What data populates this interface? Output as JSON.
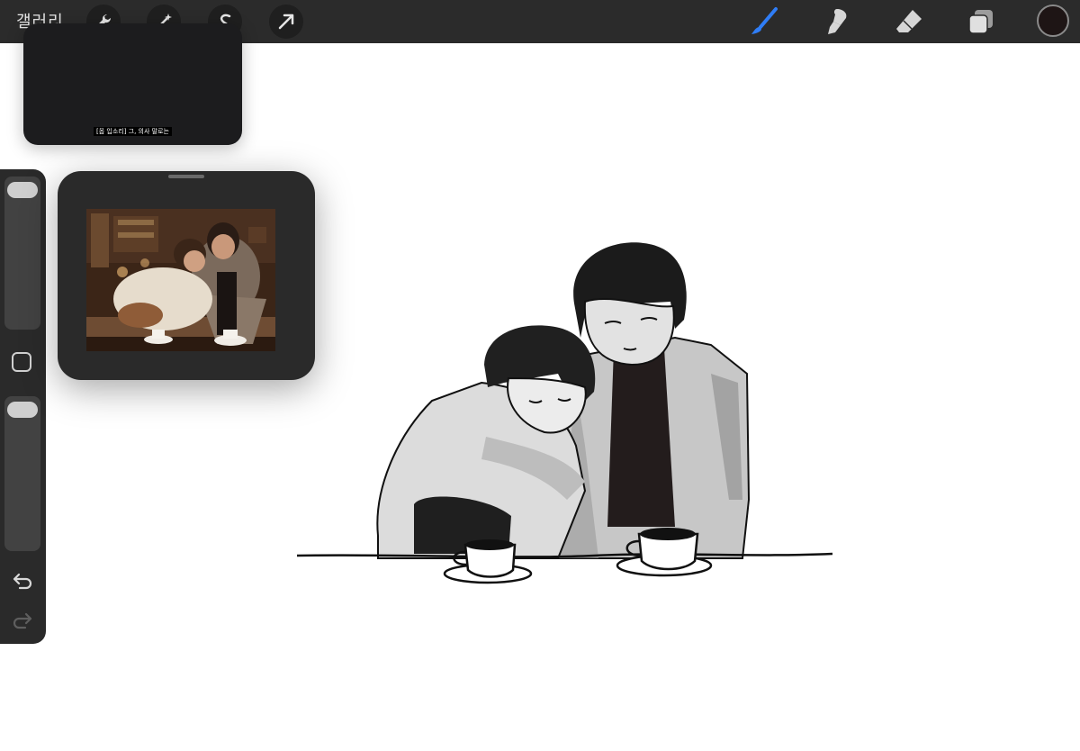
{
  "toolbar": {
    "gallery_label": "갤러리",
    "action_buttons": [
      {
        "name": "wrench-icon"
      },
      {
        "name": "magic-wand-icon"
      },
      {
        "name": "selection-icon"
      },
      {
        "name": "transform-arrow-icon"
      }
    ],
    "tools": [
      {
        "name": "brush-icon",
        "active": true
      },
      {
        "name": "smudge-icon",
        "active": false
      },
      {
        "name": "eraser-icon",
        "active": false
      },
      {
        "name": "layers-icon",
        "active": false
      }
    ],
    "current_color": "#1e1515",
    "accent_color": "#2f7df6"
  },
  "video_pip": {
    "subtitle": "[옵 입소리] 그, 의사 말로는"
  },
  "sidebar": {
    "brush_size_slider": {
      "value": 0.95
    },
    "opacity_slider": {
      "value": 0.95
    },
    "undo_icon": "undo-icon",
    "redo_icon": "redo-icon"
  },
  "reference_window": {
    "content": "reference-photo"
  }
}
